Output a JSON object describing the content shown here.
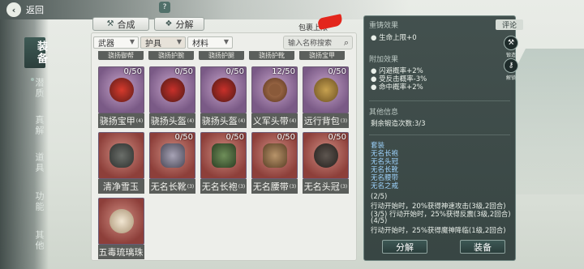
{
  "header": {
    "back_label": "返回",
    "back_icon": "‹"
  },
  "nav": {
    "active": "装备",
    "items": [
      "潜质",
      "真解",
      "道具",
      "功能",
      "其他"
    ]
  },
  "toolbar": {
    "craft_label": "合成",
    "decompose_label": "分解",
    "pack_label": "包裹上限"
  },
  "filters": {
    "weapon": "武器",
    "armor": "护具",
    "material": "材料",
    "search_placeholder": "输入名称搜索"
  },
  "partial_row": [
    "骁扬御帮",
    "骁扬护腕",
    "骁扬护腿",
    "骁扬护靴",
    "骁扬宝甲"
  ],
  "items": [
    {
      "name": "骁扬宝甲",
      "level": "(4)",
      "count": "0/50",
      "rarity": "purple"
    },
    {
      "name": "骁扬头盔",
      "level": "(4)",
      "count": "0/50",
      "rarity": "purple"
    },
    {
      "name": "骁扬头盔",
      "level": "(4)",
      "count": "0/50",
      "rarity": "purple"
    },
    {
      "name": "义军头带",
      "level": "(4)",
      "count": "12/50",
      "rarity": "purple"
    },
    {
      "name": "远行背包",
      "level": "(3)",
      "count": "0/50",
      "rarity": "purple"
    },
    {
      "name": "清净雪玉",
      "level": "",
      "count": "",
      "rarity": "red"
    },
    {
      "name": "无名长靴",
      "level": "(3)",
      "count": "0/50",
      "rarity": "red"
    },
    {
      "name": "无名长袍",
      "level": "(3)",
      "count": "0/50",
      "rarity": "red"
    },
    {
      "name": "无名腰带",
      "level": "(3)",
      "count": "0/50",
      "rarity": "red"
    },
    {
      "name": "无名头冠",
      "level": "(3)",
      "count": "0/50",
      "rarity": "red"
    },
    {
      "name": "五毒琉璃珠",
      "level": "",
      "count": "",
      "rarity": "red"
    }
  ],
  "detail": {
    "recast_title": "重铸效果",
    "review_label": "评论",
    "recast_stat": "生命上限+0",
    "extra_title": "附加效果",
    "extra_stats": [
      "闪避概率+2%",
      "受反击概率-3%",
      "命中概率+2%"
    ],
    "other_title": "其他信息",
    "other_text": "剩余锻造次数:3/3",
    "set_title": "套装",
    "set_items": [
      "无名长袍",
      "无名头冠",
      "无名长靴",
      "无名腰带",
      "无名之戒"
    ],
    "set_bonus": [
      "(2/5)",
      "行动开始时，20%获得神速攻击(3级,2回合)",
      "(3/5) 行动开始时，25%获得反震(3级,2回合)",
      "(4/5)",
      "行动开始时，25%获得魔神降临(1级,2回合)"
    ],
    "tool_forge": "锻造",
    "tool_unbind": "解锁",
    "decompose_label": "分解",
    "equip_label": "装备"
  }
}
